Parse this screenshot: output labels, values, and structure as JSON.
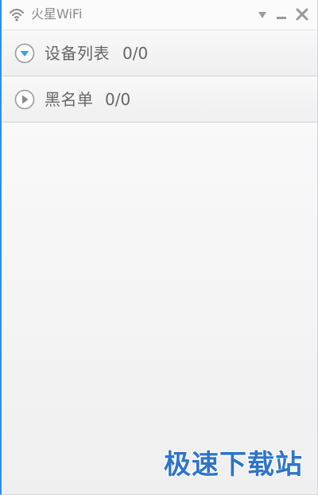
{
  "window": {
    "title": "火星WiFi",
    "app_icon": "wifi-icon",
    "controls": {
      "menu_icon": "triangle-down-icon",
      "minimize_icon": "minimize-icon",
      "close_icon": "close-icon"
    }
  },
  "sections": {
    "devices": {
      "label": "设备列表",
      "count": "0/0",
      "icon": "chevron-down-circle-icon",
      "expanded": true
    },
    "blacklist": {
      "label": "黑名单",
      "count": "0/0",
      "icon": "play-circle-icon",
      "expanded": false
    }
  },
  "watermark": {
    "text": "极速下载站"
  },
  "colors": {
    "accent_blue": "#2fa6e0",
    "border_blue": "#2f8fe0",
    "icon_gray": "#8a8a8a",
    "text_gray": "#666666",
    "watermark_blue": "#2f74c9"
  }
}
